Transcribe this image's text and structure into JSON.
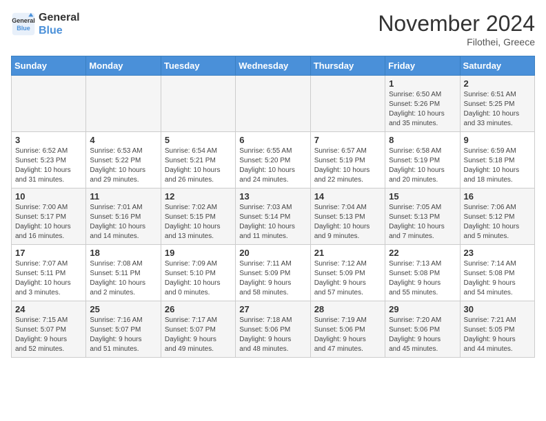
{
  "header": {
    "logo_line1": "General",
    "logo_line2": "Blue",
    "month_title": "November 2024",
    "location": "Filothei, Greece"
  },
  "days_of_week": [
    "Sunday",
    "Monday",
    "Tuesday",
    "Wednesday",
    "Thursday",
    "Friday",
    "Saturday"
  ],
  "weeks": [
    [
      {
        "day": "",
        "info": ""
      },
      {
        "day": "",
        "info": ""
      },
      {
        "day": "",
        "info": ""
      },
      {
        "day": "",
        "info": ""
      },
      {
        "day": "",
        "info": ""
      },
      {
        "day": "1",
        "info": "Sunrise: 6:50 AM\nSunset: 5:26 PM\nDaylight: 10 hours\nand 35 minutes."
      },
      {
        "day": "2",
        "info": "Sunrise: 6:51 AM\nSunset: 5:25 PM\nDaylight: 10 hours\nand 33 minutes."
      }
    ],
    [
      {
        "day": "3",
        "info": "Sunrise: 6:52 AM\nSunset: 5:23 PM\nDaylight: 10 hours\nand 31 minutes."
      },
      {
        "day": "4",
        "info": "Sunrise: 6:53 AM\nSunset: 5:22 PM\nDaylight: 10 hours\nand 29 minutes."
      },
      {
        "day": "5",
        "info": "Sunrise: 6:54 AM\nSunset: 5:21 PM\nDaylight: 10 hours\nand 26 minutes."
      },
      {
        "day": "6",
        "info": "Sunrise: 6:55 AM\nSunset: 5:20 PM\nDaylight: 10 hours\nand 24 minutes."
      },
      {
        "day": "7",
        "info": "Sunrise: 6:57 AM\nSunset: 5:19 PM\nDaylight: 10 hours\nand 22 minutes."
      },
      {
        "day": "8",
        "info": "Sunrise: 6:58 AM\nSunset: 5:19 PM\nDaylight: 10 hours\nand 20 minutes."
      },
      {
        "day": "9",
        "info": "Sunrise: 6:59 AM\nSunset: 5:18 PM\nDaylight: 10 hours\nand 18 minutes."
      }
    ],
    [
      {
        "day": "10",
        "info": "Sunrise: 7:00 AM\nSunset: 5:17 PM\nDaylight: 10 hours\nand 16 minutes."
      },
      {
        "day": "11",
        "info": "Sunrise: 7:01 AM\nSunset: 5:16 PM\nDaylight: 10 hours\nand 14 minutes."
      },
      {
        "day": "12",
        "info": "Sunrise: 7:02 AM\nSunset: 5:15 PM\nDaylight: 10 hours\nand 13 minutes."
      },
      {
        "day": "13",
        "info": "Sunrise: 7:03 AM\nSunset: 5:14 PM\nDaylight: 10 hours\nand 11 minutes."
      },
      {
        "day": "14",
        "info": "Sunrise: 7:04 AM\nSunset: 5:13 PM\nDaylight: 10 hours\nand 9 minutes."
      },
      {
        "day": "15",
        "info": "Sunrise: 7:05 AM\nSunset: 5:13 PM\nDaylight: 10 hours\nand 7 minutes."
      },
      {
        "day": "16",
        "info": "Sunrise: 7:06 AM\nSunset: 5:12 PM\nDaylight: 10 hours\nand 5 minutes."
      }
    ],
    [
      {
        "day": "17",
        "info": "Sunrise: 7:07 AM\nSunset: 5:11 PM\nDaylight: 10 hours\nand 3 minutes."
      },
      {
        "day": "18",
        "info": "Sunrise: 7:08 AM\nSunset: 5:11 PM\nDaylight: 10 hours\nand 2 minutes."
      },
      {
        "day": "19",
        "info": "Sunrise: 7:09 AM\nSunset: 5:10 PM\nDaylight: 10 hours\nand 0 minutes."
      },
      {
        "day": "20",
        "info": "Sunrise: 7:11 AM\nSunset: 5:09 PM\nDaylight: 9 hours\nand 58 minutes."
      },
      {
        "day": "21",
        "info": "Sunrise: 7:12 AM\nSunset: 5:09 PM\nDaylight: 9 hours\nand 57 minutes."
      },
      {
        "day": "22",
        "info": "Sunrise: 7:13 AM\nSunset: 5:08 PM\nDaylight: 9 hours\nand 55 minutes."
      },
      {
        "day": "23",
        "info": "Sunrise: 7:14 AM\nSunset: 5:08 PM\nDaylight: 9 hours\nand 54 minutes."
      }
    ],
    [
      {
        "day": "24",
        "info": "Sunrise: 7:15 AM\nSunset: 5:07 PM\nDaylight: 9 hours\nand 52 minutes."
      },
      {
        "day": "25",
        "info": "Sunrise: 7:16 AM\nSunset: 5:07 PM\nDaylight: 9 hours\nand 51 minutes."
      },
      {
        "day": "26",
        "info": "Sunrise: 7:17 AM\nSunset: 5:07 PM\nDaylight: 9 hours\nand 49 minutes."
      },
      {
        "day": "27",
        "info": "Sunrise: 7:18 AM\nSunset: 5:06 PM\nDaylight: 9 hours\nand 48 minutes."
      },
      {
        "day": "28",
        "info": "Sunrise: 7:19 AM\nSunset: 5:06 PM\nDaylight: 9 hours\nand 47 minutes."
      },
      {
        "day": "29",
        "info": "Sunrise: 7:20 AM\nSunset: 5:06 PM\nDaylight: 9 hours\nand 45 minutes."
      },
      {
        "day": "30",
        "info": "Sunrise: 7:21 AM\nSunset: 5:05 PM\nDaylight: 9 hours\nand 44 minutes."
      }
    ]
  ]
}
